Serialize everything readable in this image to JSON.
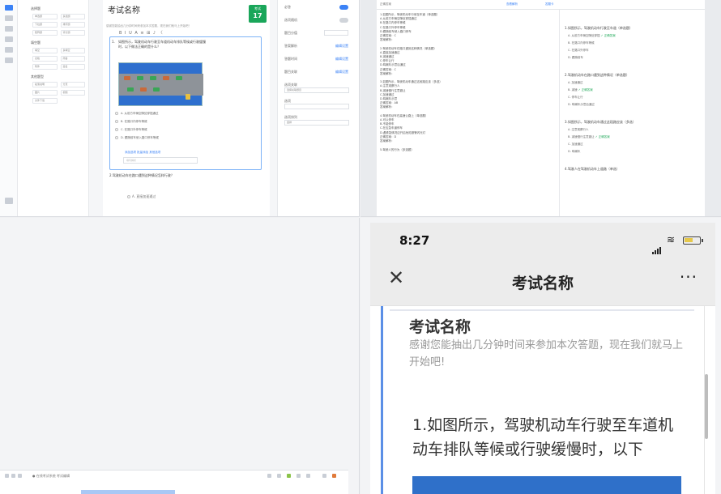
{
  "editor": {
    "title": "考试名称",
    "description": "感谢您能抽出几分钟时间来参加本次答题，现在我们就马上开始吧！",
    "badge_label": "考试",
    "badge_value": "17",
    "toolbar": "B I U A ≡ ⊞ ♪ 〈",
    "sidebar_sections": [
      {
        "name": "选择题",
        "items": [
          "单选题",
          "多选题",
          "下拉题",
          "排序题",
          "矩阵题",
          "评分题"
        ]
      },
      {
        "name": "填空题",
        "items": [
          "填空",
          "多填空",
          "表格",
          "简答",
          "附件",
          "签名"
        ]
      },
      {
        "name": "其他题型",
        "items": [
          "段落说明",
          "分页",
          "图片",
          "视频",
          "文件下载"
        ]
      }
    ],
    "q1_number": "1.",
    "q1_text": "如图所示，驾驶机动车行驶至车道机动车排队等候或行驶缓慢时，以下做法正确的是什么？",
    "q1_options": [
      "A. 从前方车辆空隙处穿插通过",
      "B. 在路口内停车等候",
      "C. 在路口外停车等候",
      "D. 跟随前车驶入路口停车等候"
    ],
    "q1_link": "添加选项  批量添加  其他选项",
    "q1_input_placeholder": "填写解析",
    "q2_text": "2.驾驶机动车在路口遇到这种情况怎样行驶？",
    "q2_option": "A. 直接加速通过",
    "props": [
      {
        "label": "必答",
        "type": "toggle",
        "on": true
      },
      {
        "label": "选项随机",
        "type": "toggle",
        "on": false
      },
      {
        "label": "题目分值",
        "type": "input"
      },
      {
        "label": "答案解析",
        "type": "link",
        "value": "编辑设置"
      },
      {
        "label": "答题时间",
        "type": "link",
        "value": "编辑设置"
      },
      {
        "label": "题目关联",
        "type": "link",
        "value": "编辑设置"
      },
      {
        "label": "选项关联",
        "type": "select",
        "value": "选择关联题目"
      },
      {
        "label": "选项",
        "type": "select",
        "value": ""
      },
      {
        "label": "选项排列",
        "type": "select",
        "value": "竖排"
      }
    ]
  },
  "sheet": {
    "tabs": [
      "正确答案",
      "查看解析",
      "答题卡"
    ],
    "left_lines": [
      "1.如图所示，驾驶机动车行驶至车道（单选题）",
      "A.从前方车辆空隙处穿插通过",
      "B.在路口内停车等候",
      "C.在路口外停车等候",
      "D.跟随前车驶入路口停车",
      "正确答案：C",
      "答案解析：",
      "",
      "2.驾驶机动车在路口遇到这种情况（单选题）",
      "A.直接加速通过",
      "B.减速通过",
      "C.停车让行",
      "D.鸣喇叭示意后通过",
      "正确答案：C",
      "答案解析：",
      "",
      "3.如图所示，驾驶机动车通过这段路应该（多选）",
      "A.注意观察行人",
      "B.减速慢行注意避让",
      "C.加速通过",
      "D.鸣喇叭示意",
      "正确答案：AB",
      "答案解析：",
      "",
      "4.驾驶机动车在高速公路上（单选题）",
      "A.可以停车",
      "B.不能停车",
      "C.在应急车道停车",
      "D.遇紧急情况应开启危险报警闪光灯",
      "正确答案：D",
      "答案解析：",
      "",
      "5.驾驶人的行为（多选题）"
    ],
    "right_questions": [
      {
        "q": "1.如图所示，驾驶机动车行驶至车道（单选题）",
        "opts": [
          [
            "A. 从前方车辆空隙处穿插",
            "✓ 正确答案"
          ],
          [
            "B. 在路口内停车等候",
            ""
          ],
          [
            "C. 在路口外停车",
            ""
          ],
          [
            "D. 跟随前车",
            ""
          ]
        ]
      },
      {
        "q": "2.驾驶机动车在路口遇到这种情况（单选题）",
        "opts": [
          [
            "A. 加速通过",
            ""
          ],
          [
            "B. 减速 ",
            "✓ 正确答案"
          ],
          [
            "C. 停车让行",
            ""
          ],
          [
            "D. 鸣喇叭示意后通过",
            ""
          ]
        ]
      },
      {
        "q": "3.如图所示，驾驶机动车通过这段路应该（多选）",
        "opts": [
          [
            "A. 注意观察行人",
            ""
          ],
          [
            "B. 减速慢行注意避让",
            "✓ 正确答案"
          ],
          [
            "C. 加速通过",
            ""
          ],
          [
            "D. 鸣喇叭",
            ""
          ]
        ]
      },
      {
        "q": "4.驾驶人在驾驶机动车上道路（单选）",
        "opts": []
      }
    ]
  },
  "browser": {
    "address": "● 在线考试系统 考试编辑"
  },
  "phone": {
    "time": "8:27",
    "nav_title": "考试名称",
    "close_label": "✕",
    "more_label": "···",
    "exam_title": "考试名称",
    "exam_desc": "感谢您能抽出几分钟时间来参加本次答题，现在我们就马上开始吧!",
    "question": "1.如图所示，驾驶机动车行驶至车道机动车排队等候或行驶缓慢时，以下"
  }
}
